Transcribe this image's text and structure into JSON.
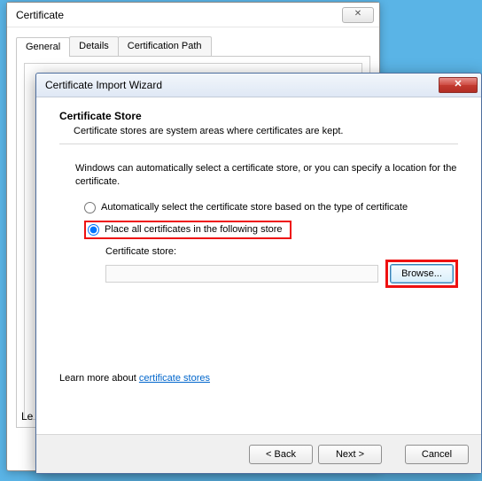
{
  "certWindow": {
    "title": "Certificate",
    "closeGlyph": "✕",
    "tabs": {
      "general": "General",
      "details": "Details",
      "path": "Certification Path"
    },
    "truncated": "Le"
  },
  "wizard": {
    "title": "Certificate Import Wizard",
    "closeGlyph": "✕",
    "section": {
      "heading": "Certificate Store",
      "desc": "Certificate stores are system areas where certificates are kept."
    },
    "instruction": "Windows can automatically select a certificate store, or you can specify a location for the certificate.",
    "radios": {
      "auto": "Automatically select the certificate store based on the type of certificate",
      "place": "Place all certificates in the following store"
    },
    "store": {
      "label": "Certificate store:",
      "value": "",
      "browse": "Browse..."
    },
    "learn": {
      "prefix": "Learn more about ",
      "link": "certificate stores"
    },
    "buttons": {
      "back": "< Back",
      "next": "Next >",
      "cancel": "Cancel"
    }
  }
}
